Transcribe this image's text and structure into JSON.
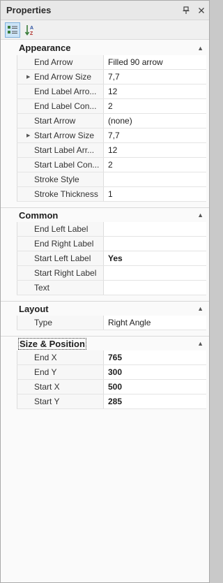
{
  "panel": {
    "title": "Properties",
    "pin_icon": "pin-icon",
    "close_icon": "close-icon"
  },
  "toolbar": {
    "categorized_icon": "categorized-icon",
    "alphabetical_icon": "sort-az-icon"
  },
  "categories": [
    {
      "label": "Appearance",
      "rows": [
        {
          "name": "End Arrow",
          "value": "Filled 90 arrow",
          "bold": false,
          "expandable": false
        },
        {
          "name": "End Arrow Size",
          "value": "7,7",
          "bold": false,
          "expandable": true
        },
        {
          "name": "End Label Arro...",
          "value": "12",
          "bold": false,
          "expandable": false
        },
        {
          "name": "End Label Con...",
          "value": "2",
          "bold": false,
          "expandable": false
        },
        {
          "name": "Start Arrow",
          "value": "(none)",
          "bold": false,
          "expandable": false
        },
        {
          "name": "Start Arrow Size",
          "value": "7,7",
          "bold": false,
          "expandable": true
        },
        {
          "name": "Start Label Arr...",
          "value": "12",
          "bold": false,
          "expandable": false
        },
        {
          "name": "Start Label Con...",
          "value": "2",
          "bold": false,
          "expandable": false
        },
        {
          "name": "Stroke Style",
          "value": "",
          "bold": false,
          "expandable": false
        },
        {
          "name": "Stroke Thickness",
          "value": "1",
          "bold": false,
          "expandable": false
        }
      ]
    },
    {
      "label": "Common",
      "rows": [
        {
          "name": "End Left Label",
          "value": "",
          "bold": false,
          "expandable": false
        },
        {
          "name": "End Right Label",
          "value": "",
          "bold": false,
          "expandable": false
        },
        {
          "name": "Start Left Label",
          "value": "Yes",
          "bold": true,
          "expandable": false
        },
        {
          "name": "Start Right Label",
          "value": "",
          "bold": false,
          "expandable": false
        },
        {
          "name": "Text",
          "value": "",
          "bold": false,
          "expandable": false
        }
      ]
    },
    {
      "label": "Layout",
      "rows": [
        {
          "name": "Type",
          "value": "Right Angle",
          "bold": false,
          "expandable": false
        }
      ]
    },
    {
      "label": "Size & Position",
      "focused": true,
      "rows": [
        {
          "name": "End X",
          "value": "765",
          "bold": true,
          "expandable": false
        },
        {
          "name": "End Y",
          "value": "300",
          "bold": true,
          "expandable": false
        },
        {
          "name": "Start X",
          "value": "500",
          "bold": true,
          "expandable": false
        },
        {
          "name": "Start Y",
          "value": "285",
          "bold": true,
          "expandable": false
        }
      ]
    }
  ]
}
